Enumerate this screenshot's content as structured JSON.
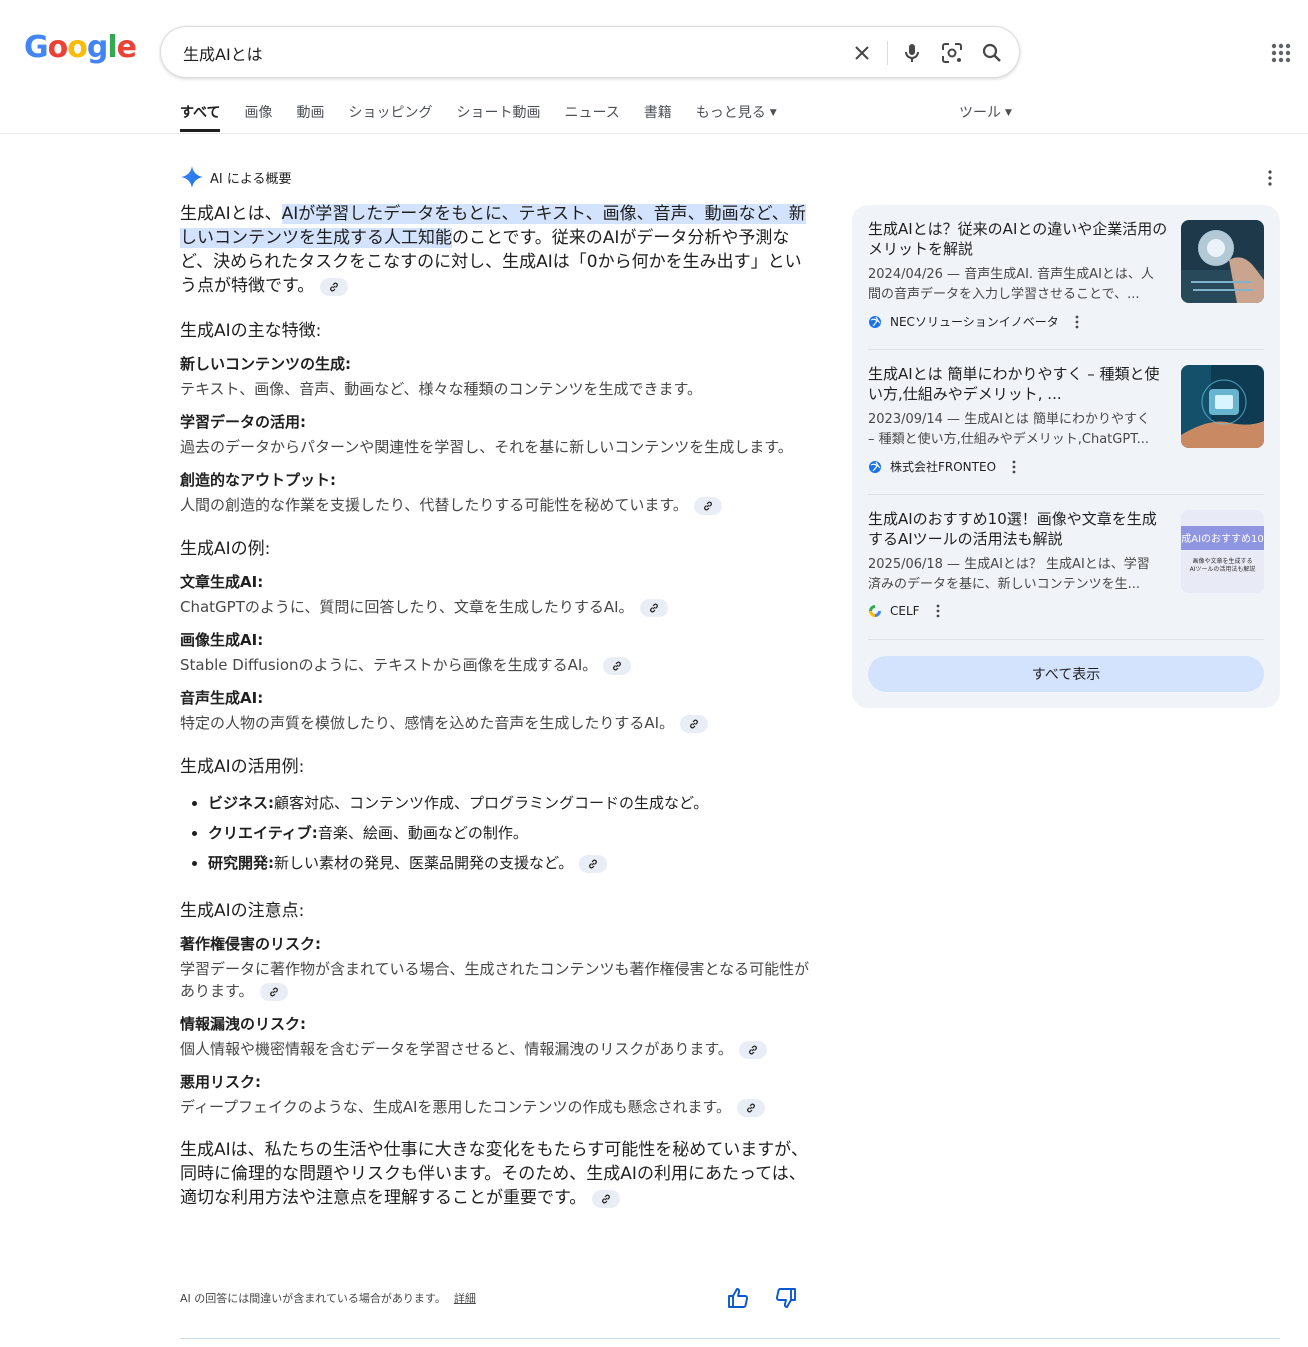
{
  "header": {
    "logo_letters": [
      {
        "char": "G",
        "color": "#4285f4"
      },
      {
        "char": "o",
        "color": "#ea4335"
      },
      {
        "char": "o",
        "color": "#fbbc05"
      },
      {
        "char": "g",
        "color": "#4285f4"
      },
      {
        "char": "l",
        "color": "#34a853"
      },
      {
        "char": "e",
        "color": "#ea4335"
      }
    ],
    "search_query": "生成AIとは"
  },
  "tabs": [
    {
      "label": "すべて"
    },
    {
      "label": "画像"
    },
    {
      "label": "動画"
    },
    {
      "label": "ショッピング"
    },
    {
      "label": "ショート動画"
    },
    {
      "label": "ニュース"
    },
    {
      "label": "書籍"
    },
    {
      "label": "もっと見る"
    }
  ],
  "tools_label": "ツール",
  "ai_overview": {
    "title": "AI による概要",
    "lead_prefix": "生成AIとは、",
    "lead_highlight": "AIが学習したデータをもとに、テキスト、画像、音声、動画など、新しいコンテンツを生成する人工知能",
    "lead_suffix": "のことです。従来のAIがデータ分析や予測など、決められたタスクをこなすのに対し、生成AIは「0から何かを生み出す」という点が特徴です。",
    "features": {
      "heading": "生成AIの主な特徴:",
      "items": [
        {
          "title": "新しいコンテンツの生成:",
          "text": "テキスト、画像、音声、動画など、様々な種類のコンテンツを生成できます。"
        },
        {
          "title": "学習データの活用:",
          "text": "過去のデータからパターンや関連性を学習し、それを基に新しいコンテンツを生成します。"
        },
        {
          "title": "創造的なアウトプット:",
          "text": "人間の創造的な作業を支援したり、代替したりする可能性を秘めています。"
        }
      ]
    },
    "examples": {
      "heading": "生成AIの例:",
      "items": [
        {
          "title": "文章生成AI:",
          "text": "ChatGPTのように、質問に回答したり、文章を生成したりするAI。"
        },
        {
          "title": "画像生成AI:",
          "text": "Stable Diffusionのように、テキストから画像を生成するAI。"
        },
        {
          "title": "音声生成AI:",
          "text": "特定の人物の声質を模倣したり、感情を込めた音声を生成したりするAI。"
        }
      ]
    },
    "uses": {
      "heading": "生成AIの活用例:",
      "items": [
        {
          "title": "ビジネス:",
          "text": "顧客対応、コンテンツ作成、プログラミングコードの生成など。"
        },
        {
          "title": "クリエイティブ:",
          "text": "音楽、絵画、動画などの制作。"
        },
        {
          "title": "研究開発:",
          "text": "新しい素材の発見、医薬品開発の支援など。"
        }
      ]
    },
    "cautions": {
      "heading": "生成AIの注意点:",
      "items": [
        {
          "title": "著作権侵害のリスク:",
          "text": "学習データに著作物が含まれている場合、生成されたコンテンツも著作権侵害となる可能性があります。"
        },
        {
          "title": "情報漏洩のリスク:",
          "text": "個人情報や機密情報を含むデータを学習させると、情報漏洩のリスクがあります。"
        },
        {
          "title": "悪用リスク:",
          "text": "ディープフェイクのような、生成AIを悪用したコンテンツの作成も懸念されます。"
        }
      ]
    },
    "closing": "生成AIは、私たちの生活や仕事に大きな変化をもたらす可能性を秘めていますが、同時に倫理的な問題やリスクも伴います。そのため、生成AIの利用にあたっては、適切な利用方法や注意点を理解することが重要です。",
    "disclaimer": "AI の回答には間違いが含まれている場合があります。",
    "disclaimer_link": "詳細"
  },
  "sources": [
    {
      "title": "生成AIとは？従来のAIとの違いや企業活用のメリットを解説",
      "snippet_line1": "2024/04/26 — 音声生成AI. 音声生成AIとは、人",
      "snippet_line2": "間の音声データを入力し学習させることで、...",
      "source": "NECソリューションイノベータ"
    },
    {
      "title": "生成AIとは 簡単にわかりやすく – 種類と使い方,仕組みやデメリット, ...",
      "snippet_line1": "2023/09/14 — 生成AIとは 簡単にわかりやすく",
      "snippet_line2": "– 種類と使い方,仕組みやデメリット,ChatGPT...",
      "source": "株式会社FRONTEO"
    },
    {
      "title": "生成AIのおすすめ10選！画像や文章を生成するAIツールの活用法も解説",
      "snippet_line1": "2025/06/18 — 生成AIとは？ 生成AIとは、学習",
      "snippet_line2": "済みのデータを基に、新しいコンテンツを生...",
      "source": "CELF",
      "image_text1": "成AIのおすすめ10",
      "image_text2": "画像や文章を生成する",
      "image_text3": "AIツールの活用法も解説"
    }
  ],
  "show_all_label": "すべて表示",
  "colors": {
    "accent": "#1a73e8",
    "highlight": "#d3e3fd",
    "panel": "#f0f4f9"
  }
}
